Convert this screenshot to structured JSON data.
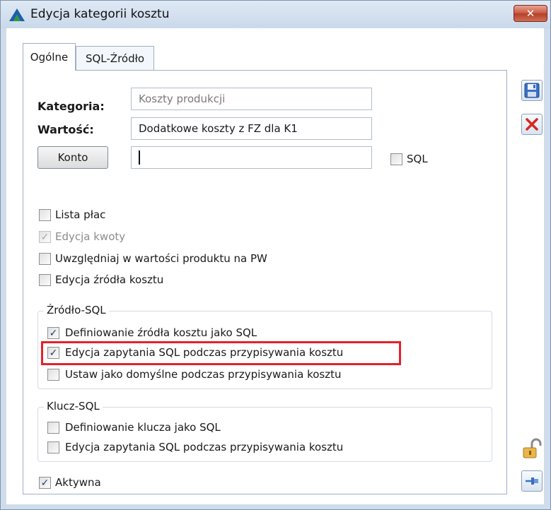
{
  "window": {
    "title": "Edycja kategorii kosztu",
    "close_label": "✕"
  },
  "tabs": [
    {
      "label": "Ogólne"
    },
    {
      "label": "SQL-Źródło"
    }
  ],
  "form": {
    "category_label": "Kategoria:",
    "category_value": "Koszty produkcji",
    "value_label": "Wartość:",
    "value_value": "Dodatkowe koszty z FZ dla K1",
    "account_button": "Konto",
    "account_value": "",
    "sql_label": "SQL"
  },
  "options": [
    {
      "label": "Lista płac",
      "checked": false,
      "disabled": false
    },
    {
      "label": "Edycja kwoty",
      "checked": true,
      "disabled": true
    },
    {
      "label": "Uwzględniaj w wartości produktu na PW",
      "checked": false,
      "disabled": false
    },
    {
      "label": "Edycja źródła kosztu",
      "checked": false,
      "disabled": false
    }
  ],
  "source_sql": {
    "title": "Źródło-SQL",
    "items": [
      {
        "label": "Definiowanie źródła kosztu jako SQL",
        "checked": true
      },
      {
        "label": "Edycja zapytania SQL podczas przypisywania kosztu",
        "checked": true
      },
      {
        "label": "Ustaw jako domyślne podczas przypisywania kosztu",
        "checked": false
      }
    ]
  },
  "key_sql": {
    "title": "Klucz-SQL",
    "items": [
      {
        "label": "Definiowanie klucza jako SQL",
        "checked": false
      },
      {
        "label": "Edycja zapytania SQL podczas przypisywania kosztu",
        "checked": false
      }
    ]
  },
  "active": {
    "label": "Aktywna",
    "checked": true
  },
  "colors": {
    "highlight": "#e5212b",
    "titlebar": "#c9d8ea",
    "frame": "#cfdcec"
  },
  "icons": {
    "app": "app-logo-icon",
    "save": "save-icon",
    "cancel": "cancel-icon",
    "lock": "lock-icon",
    "pin": "pin-icon"
  }
}
